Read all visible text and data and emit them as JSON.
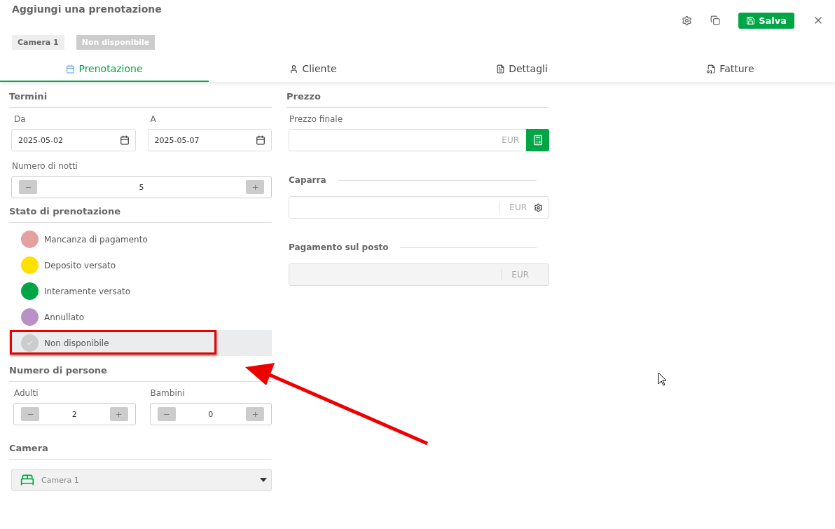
{
  "title": "Aggiungi una prenotazione",
  "actions": {
    "save": "Salva"
  },
  "chips": [
    {
      "label": "Camera 1",
      "kind": "room"
    },
    {
      "label": "Non disponibile",
      "kind": "status"
    }
  ],
  "tabs": [
    {
      "label": "Prenotazione",
      "kind": "calendar",
      "selected": true
    },
    {
      "label": "Cliente",
      "kind": "user",
      "selected": false
    },
    {
      "label": "Dettagli",
      "kind": "doc",
      "selected": false
    },
    {
      "label": "Fatture",
      "kind": "invoice",
      "selected": false
    }
  ],
  "terms": {
    "heading": "Termini",
    "from_label": "Da",
    "from": "2025-05-02",
    "to_label": "A",
    "to": "2025-05-07",
    "nights_label": "Numero di notti",
    "nights": "5"
  },
  "status": {
    "heading": "Stato di prenotazione",
    "items": [
      {
        "label": "Mancanza di pagamento",
        "color": "#e4a1a0",
        "selected": false,
        "annotated": false
      },
      {
        "label": "Deposito versato",
        "color": "#ffe100",
        "selected": false,
        "annotated": false
      },
      {
        "label": "Interamente versato",
        "color": "#00a545",
        "selected": false,
        "annotated": false
      },
      {
        "label": "Annullato",
        "color": "#b991c6",
        "selected": false,
        "annotated": false
      },
      {
        "label": "Non disponibile",
        "color": "#cccccc",
        "selected": true,
        "annotated": true
      }
    ]
  },
  "persons": {
    "heading": "Numero di persone",
    "adults_label": "Adulti",
    "adults": "2",
    "children_label": "Bambini",
    "children": "0"
  },
  "room": {
    "heading": "Camera",
    "value": "Camera 1"
  },
  "price": {
    "heading": "Prezzo",
    "final_label": "Prezzo finale",
    "currency_1": "EUR",
    "deposit_label": "Caparra",
    "currency_2": "EUR",
    "onsite_label": "Pagamento sul posto",
    "currency_3": "EUR"
  }
}
